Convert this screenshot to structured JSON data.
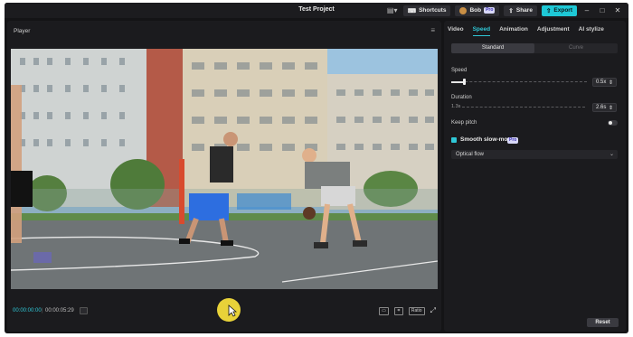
{
  "titlebar": {
    "title": "Test Project",
    "shortcuts_label": "Shortcuts",
    "user_name": "Bob",
    "user_badge": "Pro",
    "share_label": "Share",
    "export_label": "Export"
  },
  "player": {
    "header": "Player",
    "timecode_current": "00:00:00:00",
    "timecode_total": "00:00:05:29",
    "ratio_label": "Ratio",
    "full_label": "Full"
  },
  "inspector": {
    "tabs": [
      "Video",
      "Speed",
      "Animation",
      "Adjustment",
      "AI stylize"
    ],
    "active_tab": "Speed",
    "segments": [
      "Standard",
      "Curve"
    ],
    "speed_label": "Speed",
    "speed_value": "0.5x",
    "duration_label": "Duration",
    "duration_original": "1.3s",
    "duration_value": "2.6s",
    "keep_pitch_label": "Keep pitch",
    "smooth_label": "Smooth slow-mo",
    "smooth_badge": "Pro",
    "method_value": "Optical flow",
    "reset_label": "Reset"
  },
  "colors": {
    "accent": "#2fc7d6",
    "export": "#1ec8d6",
    "panel": "#1b1b1e",
    "background": "#141416"
  }
}
